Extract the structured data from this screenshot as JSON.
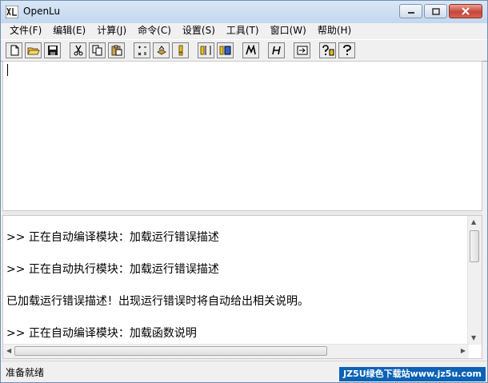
{
  "window": {
    "title": "OpenLu"
  },
  "menu": [
    "文件(F)",
    "编辑(E)",
    "计算(J)",
    "命令(C)",
    "设置(S)",
    "工具(T)",
    "窗口(W)",
    "帮助(H)"
  ],
  "toolbar": {
    "buttons": [
      "new-file-icon",
      "open-folder-icon",
      "save-icon",
      "cut-icon",
      "copy-icon",
      "paste-icon",
      "compute-icon",
      "compile-icon",
      "exclamation-icon",
      "bracket-tool-icon",
      "select-tool-icon",
      "italic-m-icon",
      "italic-h-icon",
      "arrow-box-icon",
      "help-grid-icon",
      "help-icon"
    ],
    "separator_after": [
      2,
      5,
      8,
      10,
      11,
      13
    ]
  },
  "output": {
    "lines": [
      ">> 正在自动编译模块：加载运行错误描述",
      ">> 正在自动执行模块：加载运行错误描述",
      "已加载运行错误描述！出现运行错误时将自动给出相关说明。",
      ">> 正在自动编译模块：加载函数说明"
    ]
  },
  "status": {
    "text": "准备就绪",
    "watermark": "JZ5U绿色下载站www.jz5u.com"
  },
  "colors": {
    "close": "#c8453a",
    "watermark": "#0a63b6"
  }
}
